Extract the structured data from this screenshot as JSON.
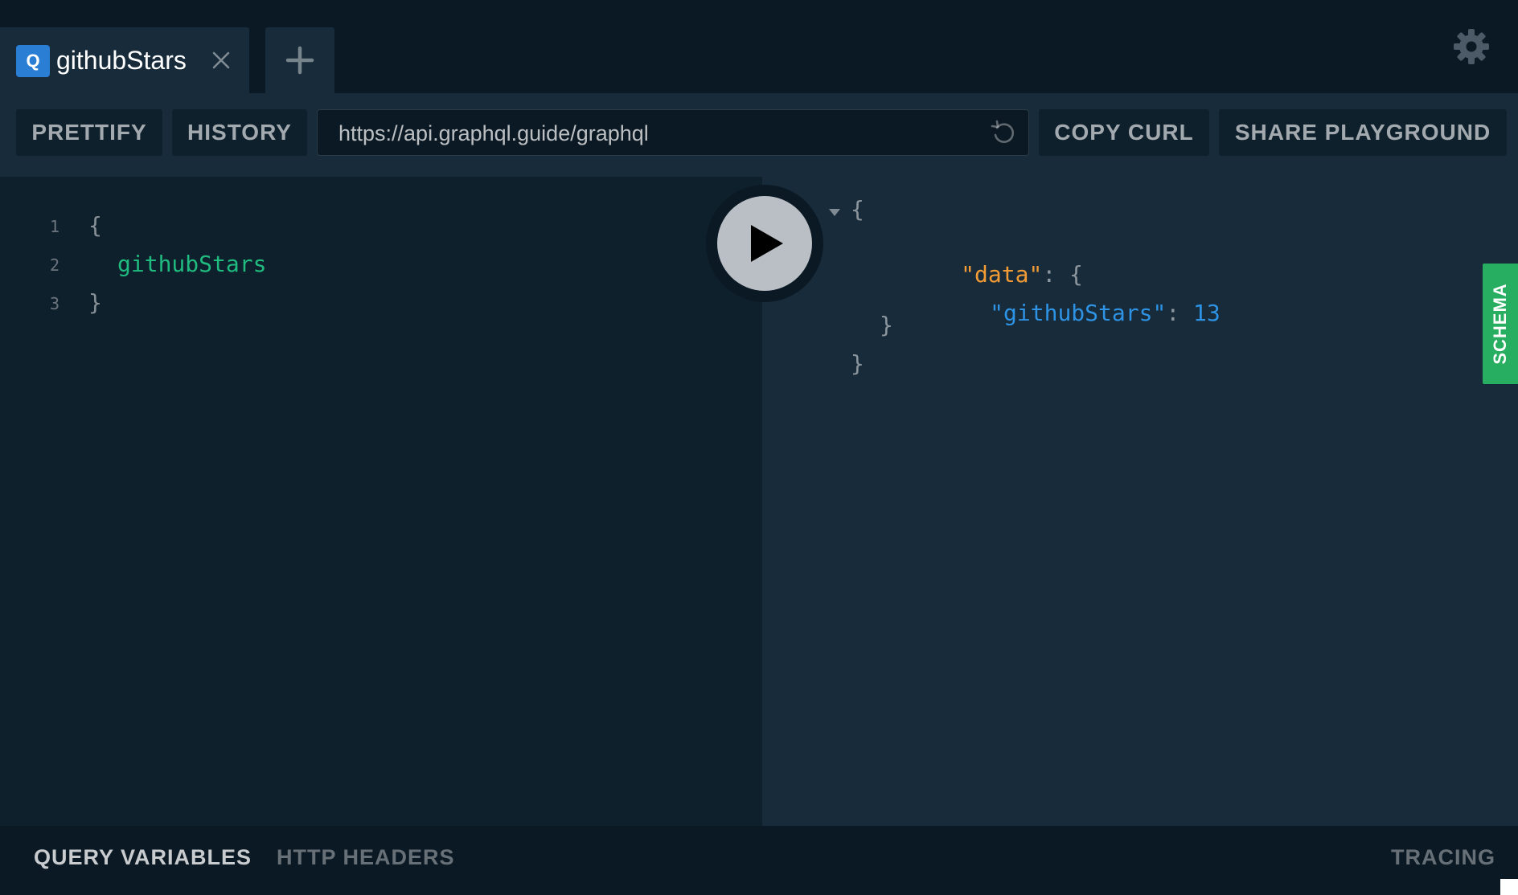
{
  "tabs": [
    {
      "badge": "Q",
      "title": "githubStars"
    }
  ],
  "icons": {
    "close": "close-icon",
    "add": "plus-icon",
    "settings": "gear-icon",
    "reload": "reload-icon",
    "run": "play-icon",
    "collapse": "caret-down-icon"
  },
  "toolbar": {
    "prettify_label": "PRETTIFY",
    "history_label": "HISTORY",
    "endpoint_url": "https://api.graphql.guide/graphql",
    "copy_curl_label": "COPY CURL",
    "share_label": "SHARE PLAYGROUND"
  },
  "query_editor": {
    "line_numbers": [
      "1",
      "2",
      "3"
    ],
    "open_brace": "{",
    "field": "githubStars",
    "close_brace": "}"
  },
  "result": {
    "open_brace": "{",
    "data_key": "\"data\"",
    "colon": ":",
    "inner_open": "{",
    "field_key": "\"githubStars\"",
    "field_value": "13",
    "inner_close": "}",
    "close_brace": "}"
  },
  "schema_tab_label": "SCHEMA",
  "bottom_tabs": {
    "query_variables": "QUERY VARIABLES",
    "http_headers": "HTTP HEADERS",
    "tracing": "TRACING"
  },
  "colors": {
    "badge": "#2a7ed3",
    "schema_tab": "#27ae60",
    "field": "#1fbb7f",
    "json_key": "#f39b35",
    "json_number": "#2e93e4",
    "background": "#0f202d"
  }
}
